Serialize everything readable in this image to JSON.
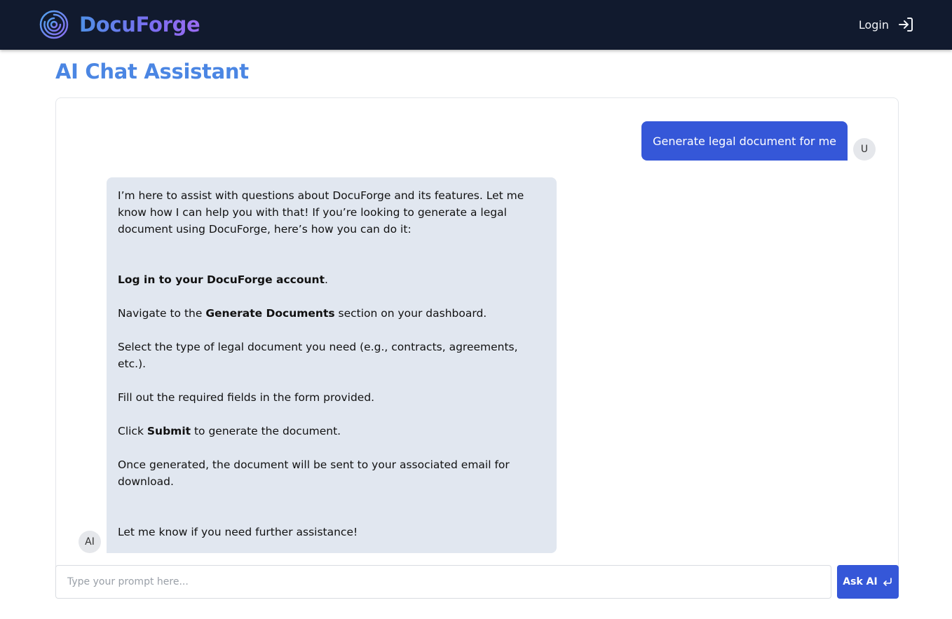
{
  "navbar": {
    "brand_name": "DocuForge",
    "login_label": "Login",
    "logo_icon": "concentric-circles-logo",
    "login_icon": "sign-in-arrow-icon",
    "background": "#111a2e"
  },
  "page": {
    "title": "AI Chat Assistant"
  },
  "chat": {
    "user_message": "Generate legal document for me",
    "user_avatar": "U",
    "ai_avatar": "AI",
    "ai_message": {
      "intro": "I’m here to assist with questions about DocuForge and its features. Let me know how I can help you with that! If you’re looking to generate a legal document using DocuForge, here’s how you can do it:",
      "step1_bold": "Log in to your DocuForge account",
      "step1_tail": ".",
      "step2_pre": "Navigate to the ",
      "step2_bold": "Generate Documents",
      "step2_post": " section on your dashboard.",
      "step3": "Select the type of legal document you need (e.g., contracts, agreements, etc.).",
      "step4": "Fill out the required fields in the form provided.",
      "step5_pre": "Click ",
      "step5_bold": "Submit",
      "step5_post": " to generate the document.",
      "step6": "Once generated, the document will be sent to your associated email for download.",
      "outro": "Let me know if you need further assistance!"
    }
  },
  "prompt": {
    "placeholder": "Type your prompt here...",
    "value": "",
    "button_label": "Ask AI",
    "button_icon": "enter-return-icon"
  },
  "colors": {
    "brand_gradient_start": "#4f8fe6",
    "brand_gradient_end": "#9b6cf2",
    "title": "#4b86e3",
    "primary_button": "#3557d8",
    "ai_bubble": "#e1e7f0",
    "avatar_bg": "#e5e7eb"
  }
}
